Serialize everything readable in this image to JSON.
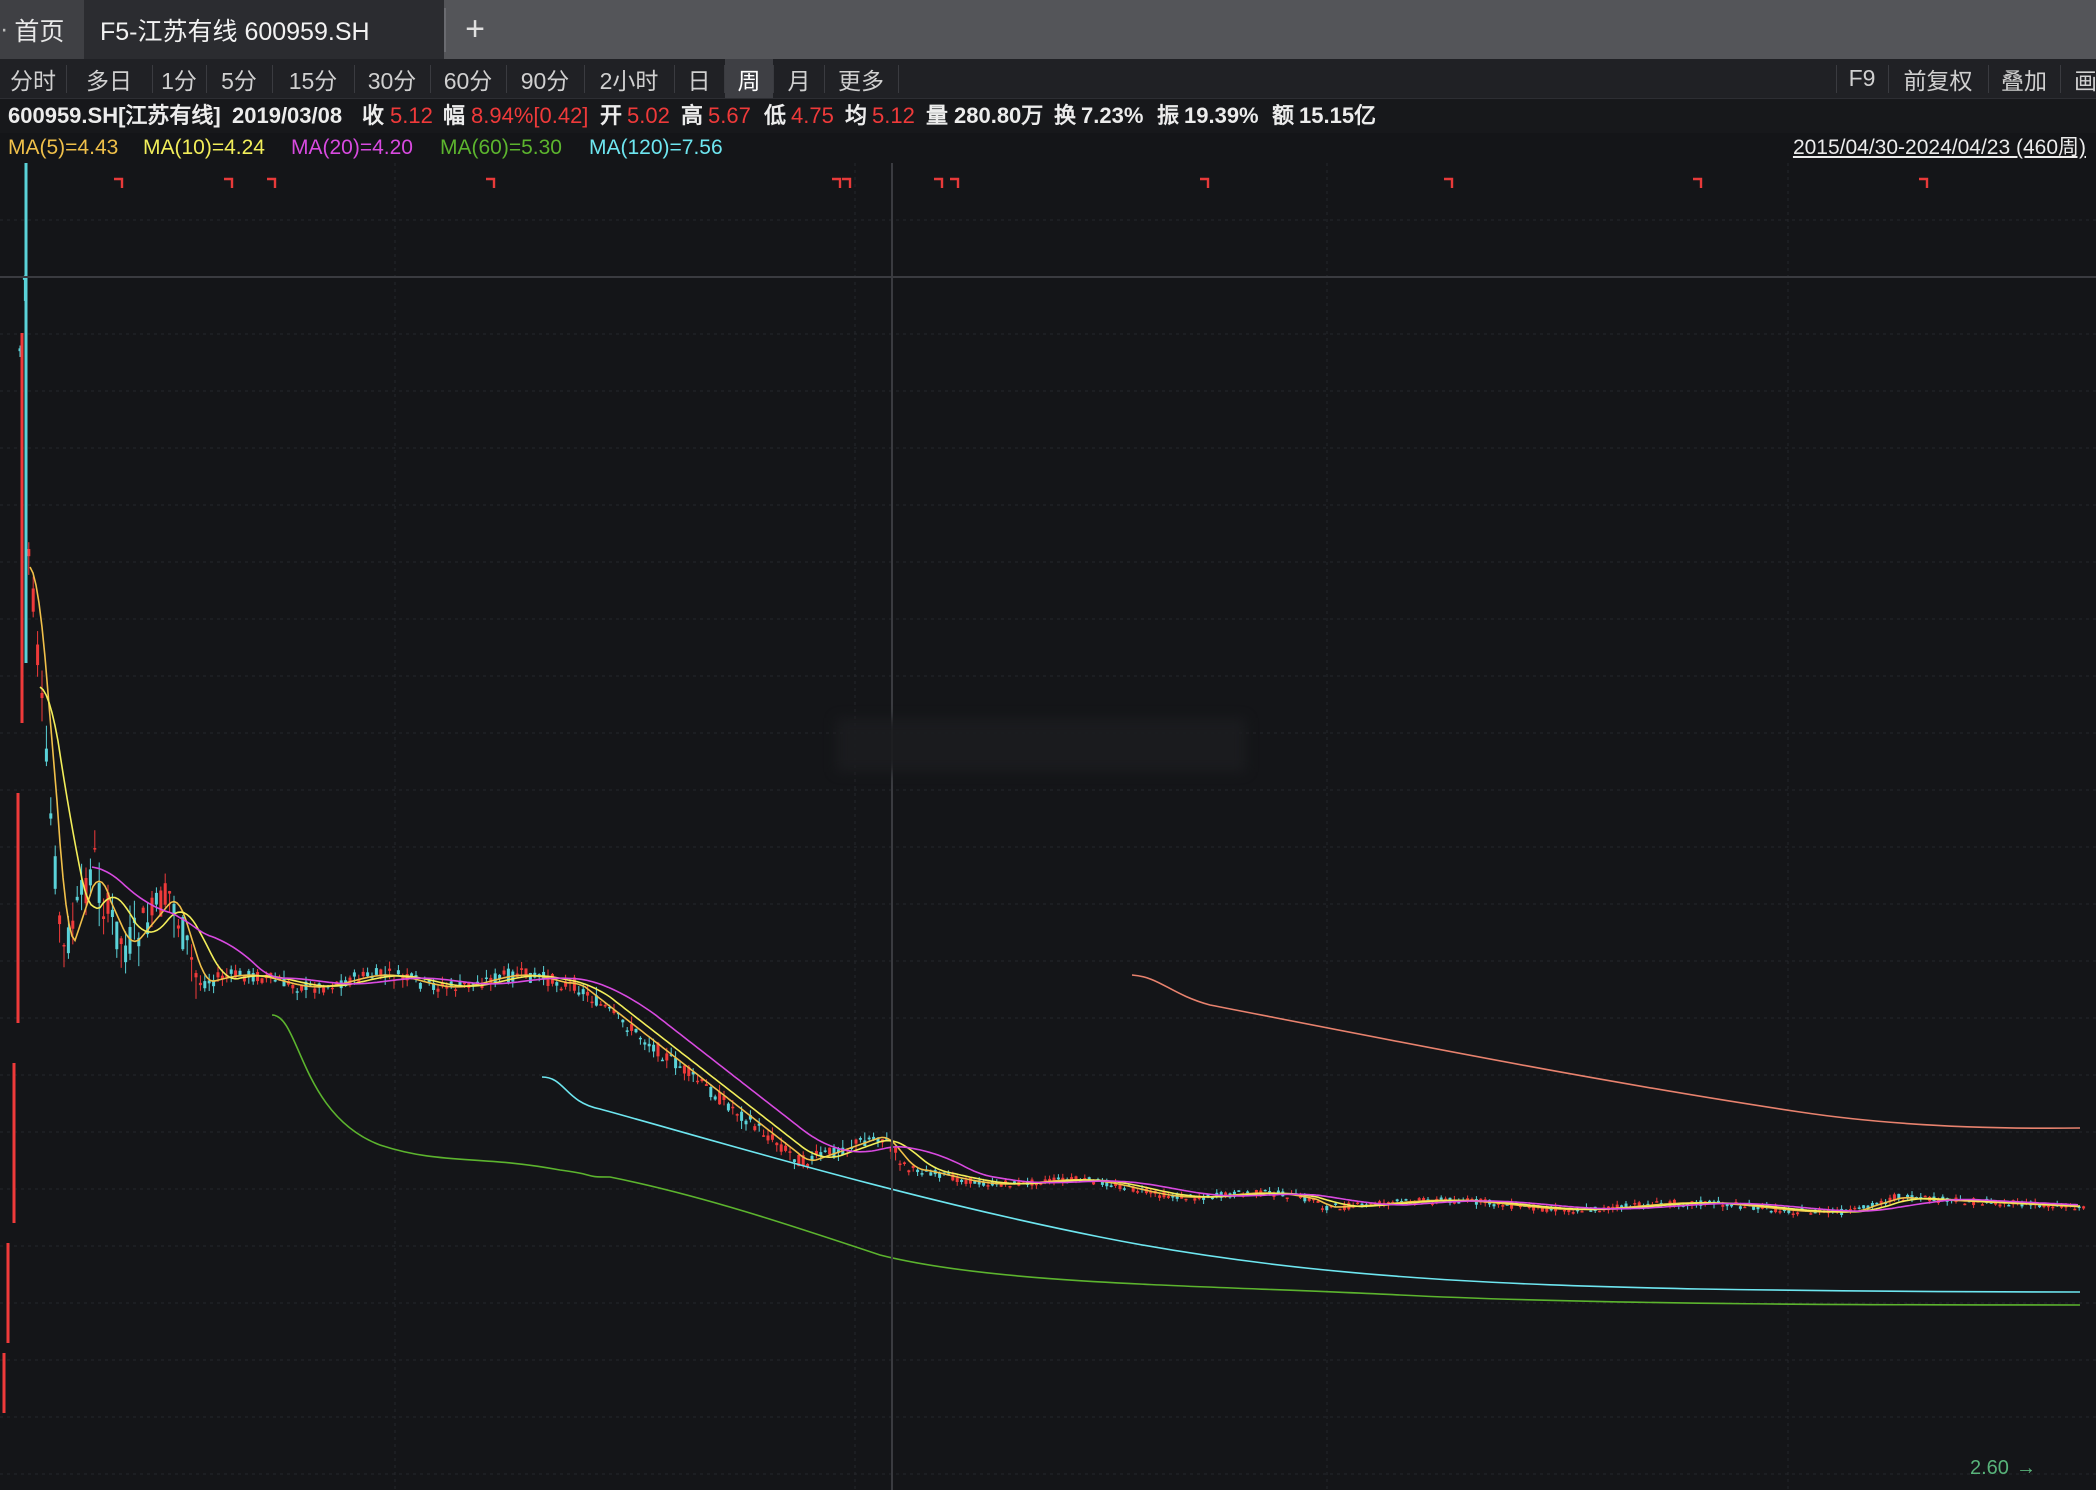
{
  "tabs": {
    "home_label": "首页",
    "active_label": "F5-江苏有线 600959.SH",
    "add_label": "+"
  },
  "toolbar": {
    "periods": [
      "分时",
      "多日",
      "1分",
      "5分",
      "15分",
      "30分",
      "60分",
      "90分",
      "2小时",
      "日",
      "周",
      "月",
      "更多"
    ],
    "selected": "周",
    "right": [
      "F9",
      "前复权",
      "叠加",
      "画"
    ]
  },
  "quote": {
    "symbol": "600959.SH[江苏有线]",
    "date": "2019/03/08",
    "close_label": "收",
    "close": "5.12",
    "change_label": "幅",
    "change": "8.94%[0.42]",
    "open_label": "开",
    "open": "5.02",
    "high_label": "高",
    "high": "5.67",
    "low_label": "低",
    "low": "4.75",
    "avg_label": "均",
    "avg": "5.12",
    "volume_label": "量",
    "volume": "280.80万",
    "turnover_label": "换",
    "turnover": "7.23%",
    "amplitude_label": "振",
    "amplitude": "19.39%",
    "amount_label": "额",
    "amount": "15.15亿"
  },
  "ma": {
    "ma5": "MA(5)=4.43",
    "ma10": "MA(10)=4.24",
    "ma20": "MA(20)=4.20",
    "ma60": "MA(60)=5.30",
    "ma120": "MA(120)=7.56"
  },
  "range_label": "2015/04/30-2024/04/23 (460周)",
  "min_price_label": "2.60",
  "colors": {
    "up": "#ef3a3a",
    "down": "#5ad2d8",
    "ma5": "#f0c04a",
    "ma10": "#f2ee5a",
    "ma20": "#d84ae0",
    "ma60": "#5cb42e",
    "ma120": "#6ee6f0",
    "ma250": "#e8826e"
  },
  "chart_data": {
    "type": "candlestick",
    "period": "weekly",
    "x_range": [
      "2015/04/30",
      "2024/04/23"
    ],
    "bars": 460,
    "min_price": 2.6,
    "selected_bar": {
      "date": "2019/03/08",
      "open": 5.02,
      "high": 5.67,
      "low": 4.75,
      "close": 5.12
    },
    "moving_averages": [
      {
        "name": "MA(5)",
        "value": 4.43
      },
      {
        "name": "MA(10)",
        "value": 4.24
      },
      {
        "name": "MA(20)",
        "value": 4.2
      },
      {
        "name": "MA(60)",
        "value": 5.3
      },
      {
        "name": "MA(120)",
        "value": 7.56
      }
    ]
  }
}
